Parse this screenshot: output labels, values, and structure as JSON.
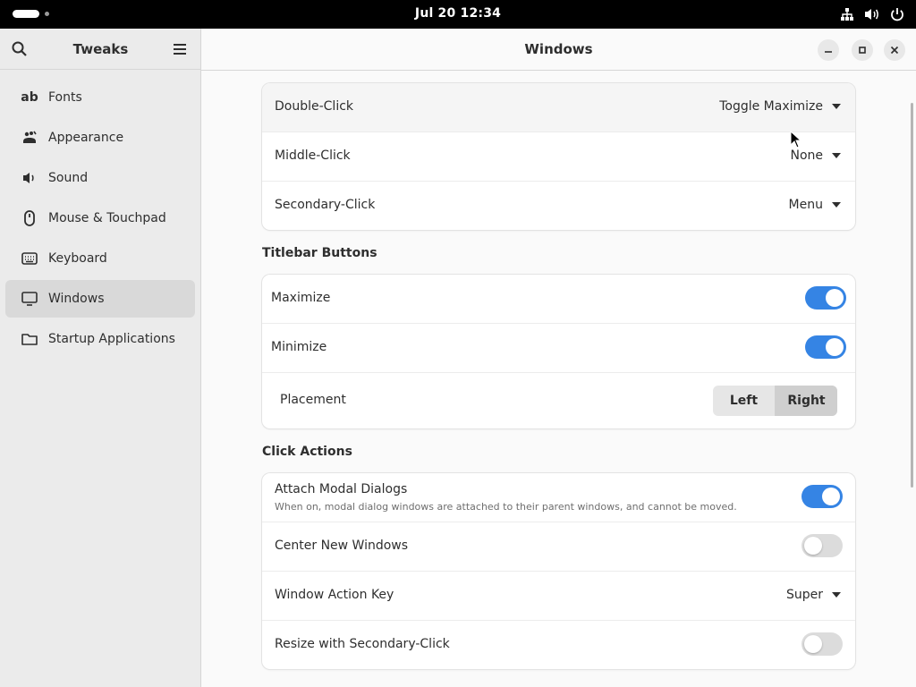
{
  "topbar": {
    "clock": "Jul 20  12:34"
  },
  "sidebar": {
    "title": "Tweaks",
    "items": [
      {
        "label": "Fonts",
        "icon": "fonts-icon"
      },
      {
        "label": "Appearance",
        "icon": "appearance-icon"
      },
      {
        "label": "Sound",
        "icon": "speaker-icon"
      },
      {
        "label": "Mouse & Touchpad",
        "icon": "mouse-icon"
      },
      {
        "label": "Keyboard",
        "icon": "keyboard-icon"
      },
      {
        "label": "Windows",
        "icon": "monitor-icon",
        "active": true
      },
      {
        "label": "Startup Applications",
        "icon": "folder-icon"
      }
    ],
    "fonts_glyph": "ab"
  },
  "header": {
    "title": "Windows"
  },
  "titlebar_actions": {
    "double_click": {
      "label": "Double-Click",
      "value": "Toggle Maximize"
    },
    "middle_click": {
      "label": "Middle-Click",
      "value": "None"
    },
    "secondary_click": {
      "label": "Secondary-Click",
      "value": "Menu"
    }
  },
  "titlebar_buttons": {
    "heading": "Titlebar Buttons",
    "maximize": {
      "label": "Maximize",
      "on": true
    },
    "minimize": {
      "label": "Minimize",
      "on": true
    },
    "placement": {
      "label": "Placement",
      "options": [
        "Left",
        "Right"
      ],
      "selected": "Right"
    }
  },
  "click_actions": {
    "heading": "Click Actions",
    "attach_modal": {
      "label": "Attach Modal Dialogs",
      "description": "When on, modal dialog windows are attached to their parent windows, and cannot be moved.",
      "on": true
    },
    "center_new": {
      "label": "Center New Windows",
      "on": false
    },
    "action_key": {
      "label": "Window Action Key",
      "value": "Super"
    },
    "resize_secondary": {
      "label": "Resize with Secondary-Click",
      "on": false
    }
  },
  "colors": {
    "accent": "#3584e4",
    "topbar": "#000000",
    "sidebar_bg": "#ebebeb",
    "content_bg": "#fafafa"
  }
}
